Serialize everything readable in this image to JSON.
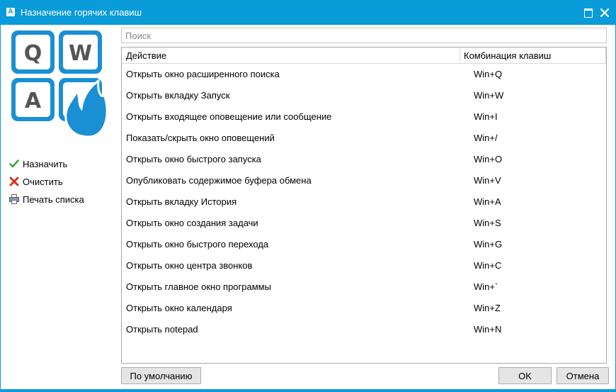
{
  "window": {
    "title": "Назначение горячих клавиш",
    "app_icon_letter": "A",
    "accent_color": "#0a9bd9"
  },
  "logo": {
    "keys": [
      "Q",
      "W",
      "A"
    ]
  },
  "actions": [
    {
      "label": "Назначить",
      "icon": "check-icon"
    },
    {
      "label": "Очистить",
      "icon": "red-x-icon"
    },
    {
      "label": "Печать списка",
      "icon": "printer-icon"
    }
  ],
  "search": {
    "placeholder": "Поиск",
    "value": ""
  },
  "grid": {
    "columns": [
      "Действие",
      "Комбинация клавиш"
    ],
    "rows": [
      {
        "action": "Открыть окно расширенного поиска",
        "keys": "Win+Q"
      },
      {
        "action": "Открыть вкладку Запуск",
        "keys": "Win+W"
      },
      {
        "action": "Открыть входящее оповещение или сообщение",
        "keys": "Win+I"
      },
      {
        "action": "Показать/скрыть окно оповещений",
        "keys": "Win+/"
      },
      {
        "action": "Открыть окно быстрого запуска",
        "keys": "Win+O"
      },
      {
        "action": "Опубликовать содержимое буфера обмена",
        "keys": "Win+V"
      },
      {
        "action": "Открыть вкладку История",
        "keys": "Win+A"
      },
      {
        "action": "Открыть окно создания задачи",
        "keys": "Win+S"
      },
      {
        "action": "Открыть окно быстрого перехода",
        "keys": "Win+G"
      },
      {
        "action": "Открыть окно центра звонков",
        "keys": "Win+C"
      },
      {
        "action": "Открыть главное окно программы",
        "keys": "Win+`"
      },
      {
        "action": "Открыть окно календаря",
        "keys": "Win+Z"
      },
      {
        "action": "Открыть notepad",
        "keys": "Win+N"
      }
    ]
  },
  "buttons": {
    "default_label": "По умолчанию",
    "ok_label": "OK",
    "cancel_label": "Отмена"
  }
}
